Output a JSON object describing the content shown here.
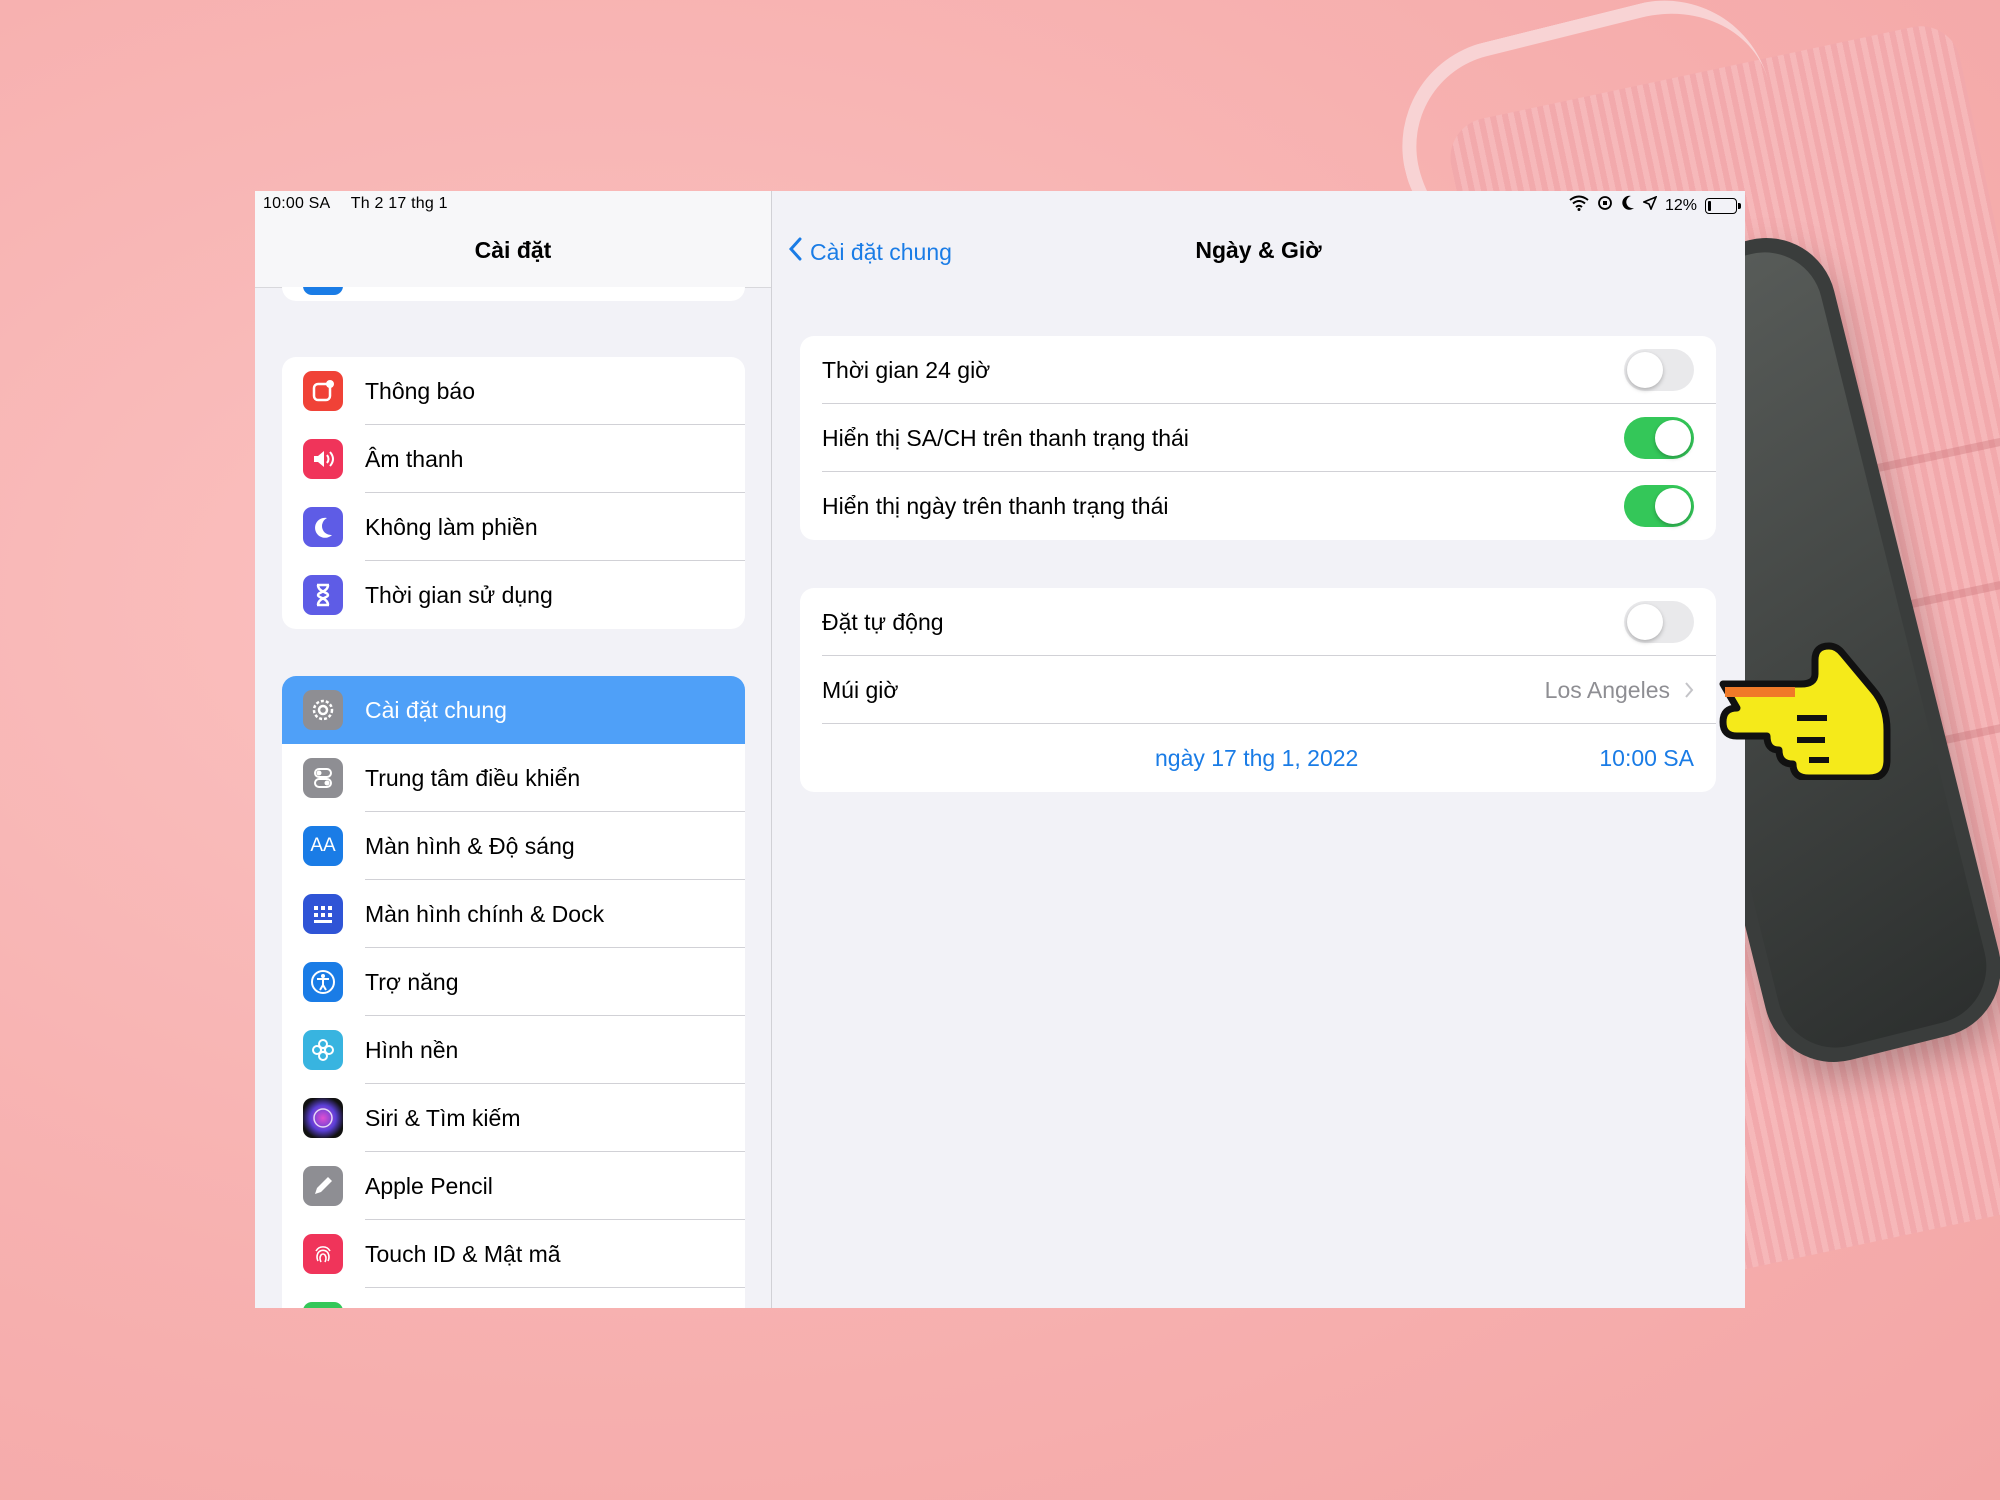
{
  "status_bar": {
    "time": "10:00 SA",
    "date": "Th 2 17 thg 1",
    "battery": "12%"
  },
  "sidebar": {
    "title": "Cài đặt",
    "group1": [
      {
        "label": "Thông báo",
        "color": "#f04237"
      },
      {
        "label": "Âm thanh",
        "color": "#f0345a"
      },
      {
        "label": "Không làm phiền",
        "color": "#5e5ce6"
      },
      {
        "label": "Thời gian sử dụng",
        "color": "#5e5ce6"
      }
    ],
    "group2": [
      {
        "label": "Cài đặt chung",
        "color": "#8e8e93",
        "selected": true
      },
      {
        "label": "Trung tâm điều khiển",
        "color": "#8e8e93"
      },
      {
        "label": "Màn hình & Độ sáng",
        "color": "#1a7ce6",
        "icon_text": "AA"
      },
      {
        "label": "Màn hình chính & Dock",
        "color": "#2f54d6"
      },
      {
        "label": "Trợ năng",
        "color": "#1a7ce6"
      },
      {
        "label": "Hình nền",
        "color": "#38b4e0"
      },
      {
        "label": "Siri & Tìm kiếm",
        "color": "#222"
      },
      {
        "label": "Apple Pencil",
        "color": "#8e8e93"
      },
      {
        "label": "Touch ID & Mật mã",
        "color": "#f0345a"
      }
    ]
  },
  "detail": {
    "back_label": "Cài đặt chung",
    "title": "Ngày & Giờ",
    "card1": [
      {
        "label": "Thời gian 24 giờ",
        "on": false
      },
      {
        "label": "Hiển thị SA/CH trên thanh trạng thái",
        "on": true
      },
      {
        "label": "Hiển thị ngày trên thanh trạng thái",
        "on": true
      }
    ],
    "card2": {
      "auto_label": "Đặt tự động",
      "auto_on": false,
      "timezone_label": "Múi giờ",
      "timezone_value": "Los Angeles",
      "date_value": "ngày 17 thg 1, 2022",
      "time_value": "10:00 SA"
    }
  }
}
